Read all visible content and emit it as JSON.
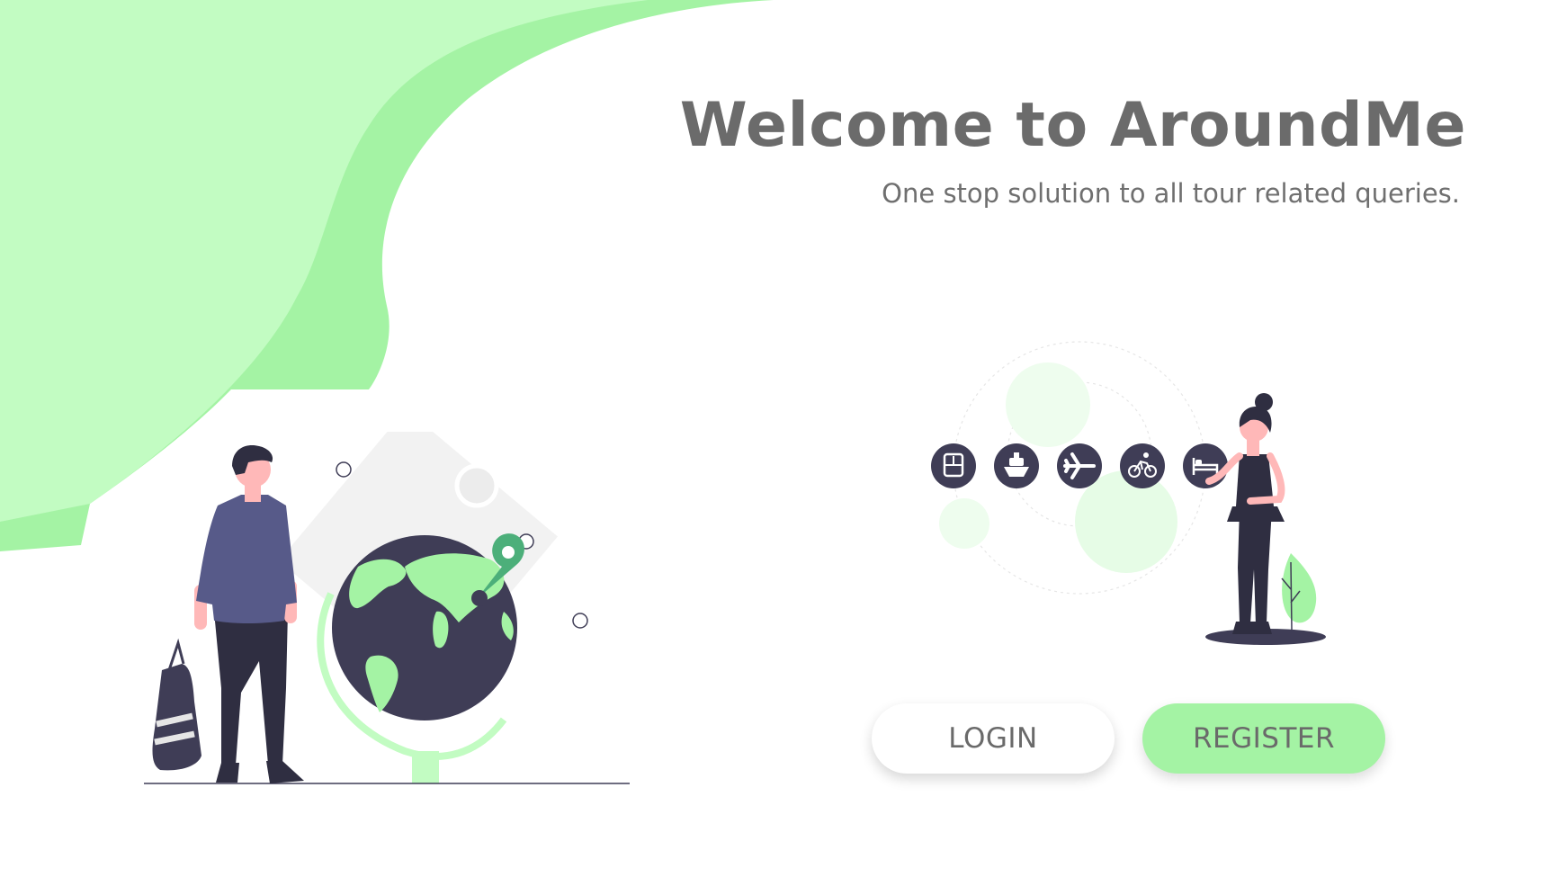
{
  "header": {
    "title": "Welcome to AroundMe",
    "subtitle": "One stop solution to all tour related queries."
  },
  "actions": {
    "login_label": "LOGIN",
    "register_label": "REGISTER"
  },
  "travel_icons": [
    "bus-icon",
    "ship-icon",
    "airplane-icon",
    "bicycle-icon",
    "hotel-bed-icon"
  ],
  "colors": {
    "accent_green": "#a4f3a4",
    "light_green": "#c2fcc2",
    "dark_navy": "#3f3d56",
    "text_gray": "#6b6b6b",
    "shirt_purple": "#575a89"
  }
}
